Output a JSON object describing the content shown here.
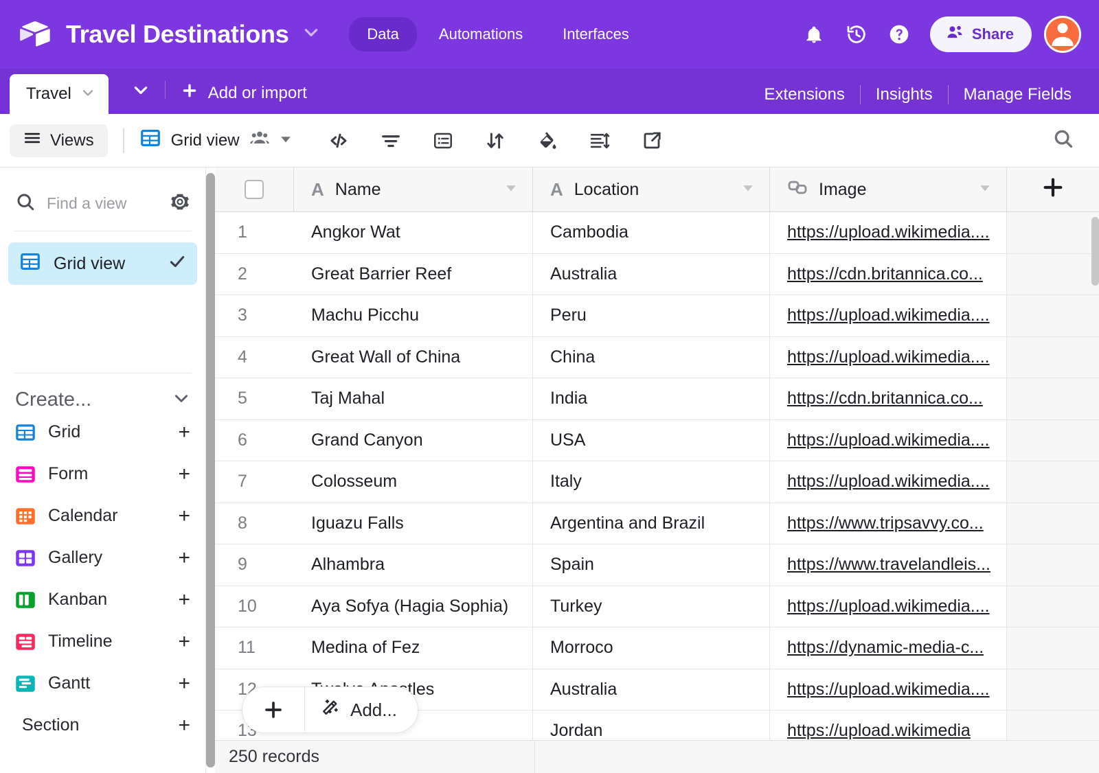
{
  "header": {
    "logo_icon": "airtable-cube-icon",
    "base_title": "Travel Destinations",
    "title_caret_icon": "chevron-down-icon",
    "nav_tabs": [
      {
        "label": "Data",
        "active": true
      },
      {
        "label": "Automations",
        "active": false
      },
      {
        "label": "Interfaces",
        "active": false
      }
    ],
    "icons": [
      "bell-icon",
      "history-icon",
      "help-icon"
    ],
    "share_label": "Share",
    "share_icon": "people-icon",
    "avatar_icon": "user-avatar"
  },
  "tabstrip": {
    "active_table": "Travel",
    "table_caret_icon": "chevron-down-icon",
    "strip_caret_icon": "chevron-down-icon",
    "add_or_import": "Add or import",
    "add_icon": "plus-icon",
    "right_links": [
      "Extensions",
      "Insights",
      "Manage Fields"
    ]
  },
  "toolbar": {
    "views_label": "Views",
    "views_icon": "hamburger-icon",
    "grid_view_label": "Grid view",
    "grid_view_icon": "grid-icon",
    "collaborators_icon": "people-group-icon",
    "grid_view_caret_icon": "chevron-down-icon",
    "icons": [
      "code-icon",
      "filter-icon",
      "group-icon",
      "sort-icon",
      "color-fill-icon",
      "row-height-icon",
      "share-export-icon"
    ],
    "search_icon": "search-icon"
  },
  "sidebar": {
    "search_placeholder": "Find a view",
    "search_icon": "search-icon",
    "settings_icon": "gear-icon",
    "views": [
      {
        "label": "Grid view",
        "icon": "grid-icon",
        "selected": true,
        "check_icon": "check-icon"
      }
    ],
    "create_label": "Create...",
    "create_caret_icon": "chevron-down-icon",
    "create_items": [
      {
        "label": "Grid",
        "icon": "grid-icon",
        "color": "#1283da",
        "add_icon": "plus-icon"
      },
      {
        "label": "Form",
        "icon": "form-icon",
        "color": "#ff08c2",
        "add_icon": "plus-icon"
      },
      {
        "label": "Calendar",
        "icon": "calendar-icon",
        "color": "#ff6f2c",
        "add_icon": "plus-icon"
      },
      {
        "label": "Gallery",
        "icon": "gallery-icon",
        "color": "#7c37ef",
        "add_icon": "plus-icon"
      },
      {
        "label": "Kanban",
        "icon": "kanban-icon",
        "color": "#04a12c",
        "add_icon": "plus-icon"
      },
      {
        "label": "Timeline",
        "icon": "timeline-icon",
        "color": "#f82b60",
        "add_icon": "plus-icon"
      },
      {
        "label": "Gantt",
        "icon": "gantt-icon",
        "color": "#0ab5b5",
        "add_icon": "plus-icon"
      }
    ],
    "section_label": "Section",
    "section_add_icon": "plus-icon"
  },
  "grid": {
    "select_all_checkbox": "unchecked",
    "columns": [
      {
        "label": "Name",
        "type_icon": "text-field-icon",
        "caret_icon": "chevron-down-icon"
      },
      {
        "label": "Location",
        "type_icon": "text-field-icon",
        "caret_icon": "chevron-down-icon"
      },
      {
        "label": "Image",
        "type_icon": "attachment-icon",
        "caret_icon": "chevron-down-icon"
      }
    ],
    "add_field_icon": "plus-icon",
    "rows": [
      {
        "num": "1",
        "name": "Angkor Wat",
        "location": "Cambodia",
        "image": "https://upload.wikimedia...."
      },
      {
        "num": "2",
        "name": "Great Barrier Reef",
        "location": "Australia",
        "image": "https://cdn.britannica.co..."
      },
      {
        "num": "3",
        "name": "Machu Picchu",
        "location": "Peru",
        "image": "https://upload.wikimedia...."
      },
      {
        "num": "4",
        "name": "Great Wall of China",
        "location": "China",
        "image": "https://upload.wikimedia...."
      },
      {
        "num": "5",
        "name": "Taj Mahal",
        "location": "India",
        "image": "https://cdn.britannica.co..."
      },
      {
        "num": "6",
        "name": "Grand Canyon",
        "location": "USA",
        "image": "https://upload.wikimedia...."
      },
      {
        "num": "7",
        "name": "Colosseum",
        "location": "Italy",
        "image": "https://upload.wikimedia...."
      },
      {
        "num": "8",
        "name": "Iguazu Falls",
        "location": "Argentina and Brazil",
        "image": "https://www.tripsavvy.co..."
      },
      {
        "num": "9",
        "name": "Alhambra",
        "location": "Spain",
        "image": "https://www.travelandleis..."
      },
      {
        "num": "10",
        "name": "Aya Sofya (Hagia Sophia)",
        "location": "Turkey",
        "image": "https://upload.wikimedia...."
      },
      {
        "num": "11",
        "name": "Medina of Fez",
        "location": "Morroco",
        "image": "https://dynamic-media-c..."
      },
      {
        "num": "12",
        "name": "Twelve Apostles",
        "location": "Australia",
        "image": "https://upload.wikimedia...."
      },
      {
        "num": "13",
        "name": "",
        "location": "Jordan",
        "image": "https://upload.wikimedia"
      }
    ],
    "add_row_plus_icon": "plus-icon",
    "add_row_label": "Add...",
    "add_row_magic_icon": "magic-wand-icon",
    "record_count": "250 records"
  },
  "colors": {
    "brand_purple": "#7c37e0",
    "tabstrip_purple": "#7533d6",
    "selected_view_bg": "#cfeefc",
    "grid_blue": "#1283da",
    "avatar_orange": "#f96c3d"
  }
}
